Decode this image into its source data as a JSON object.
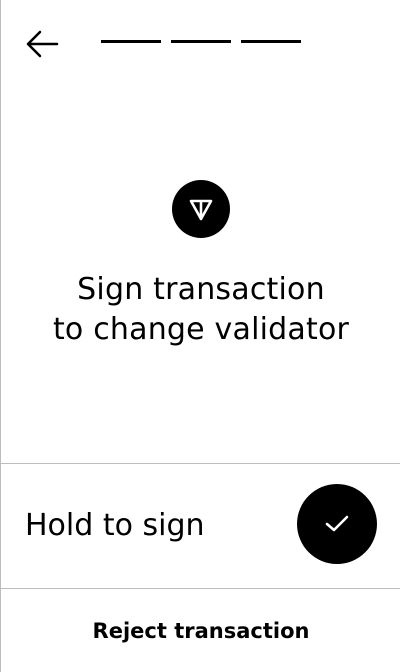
{
  "header": {
    "back_icon": "arrow-left-icon",
    "progress_steps_total": 3,
    "progress_steps_filled": 3
  },
  "main": {
    "logo_icon": "ton-logo-icon",
    "title_line1": "Sign transaction",
    "title_line2": "to change validator"
  },
  "hold": {
    "label": "Hold to sign",
    "button_icon": "checkmark-icon"
  },
  "footer": {
    "reject_label": "Reject transaction"
  },
  "colors": {
    "background": "#ffffff",
    "foreground": "#000000",
    "divider": "#bdbdbd"
  }
}
